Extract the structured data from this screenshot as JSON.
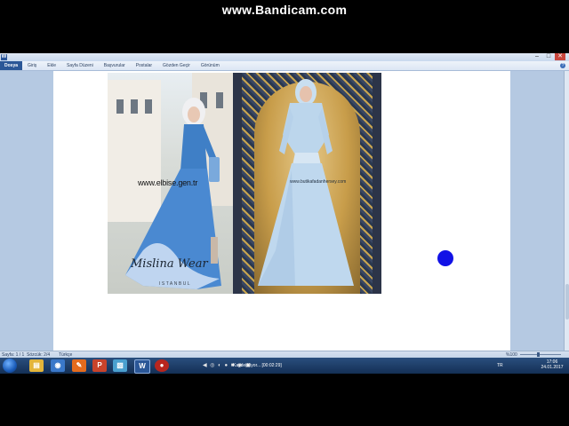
{
  "watermark": "www.Bandicam.com",
  "window": {
    "title": "",
    "minimize_glyph": "–",
    "maximize_glyph": "□",
    "close_glyph": "✕"
  },
  "ribbon": {
    "tabs": [
      "Dosya",
      "Giriş",
      "Ekle",
      "Sayfa Düzeni",
      "Başvurular",
      "Postalar",
      "Gözden Geçir",
      "Görünüm"
    ]
  },
  "document": {
    "photo": {
      "left_website": "www.elbise.gen.tr",
      "right_website": "www.butikafadanhersey.com",
      "brand": "Mislina Wear",
      "city": "ISTANBUL"
    }
  },
  "status_bar": {
    "page": "Sayfa: 1 / 1",
    "words": "Sözcük: 2/4",
    "language": "Türkçe",
    "zoom": "%100",
    "zoom_level_fraction": 0.45
  },
  "taskbar": {
    "recording_label": "Kaydediliyor... [00:02:29]",
    "recording_controls": "◀ ◎ ◐ ● ■ ◉ ▣",
    "tray_language": "TR",
    "time": "17:06",
    "date": "24.01.2017"
  },
  "colors": {
    "file_tab": "#2b5797",
    "blue_dot": "#1212e6",
    "taskbar": "#1e3f6b"
  }
}
